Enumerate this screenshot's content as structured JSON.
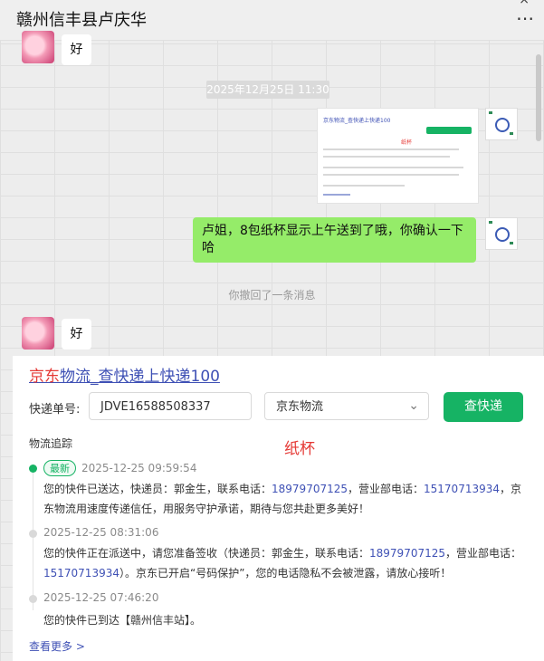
{
  "header": {
    "title": "赣州信丰县卢庆华",
    "more_icon": "⋯",
    "close_icon": "×"
  },
  "chat": {
    "msg1": "好",
    "time": "2025年12月25日 11:30",
    "outgoing": "卢姐，8包纸杯显示上午送到了哦，你确认一下哈",
    "recall_notice": "你撤回了一条消息",
    "msg2": "好"
  },
  "card": {
    "title_red": "京东",
    "title_rest": "物流_查快递上快递100",
    "tracking_label": "快递单号:",
    "tracking_value": "JDVE16588508337",
    "carrier": "京东物流",
    "query_button": "查快递",
    "tracking_section": "物流追踪",
    "stamp_text": "纸杯",
    "events": [
      {
        "badge": "最新",
        "date": "2025-12-25 09:59:54",
        "text_a": "您的快件已送达，快递员：郭金生，联系电话：",
        "phone1": "18979707125",
        "text_b": "，营业部电话：",
        "phone2": "15170713934",
        "text_c": "，京东物流用速度传递信任，用服务守护承诺，期待与您共赴更多美好！"
      },
      {
        "date": "2025-12-25 08:31:06",
        "text_a": "您的快件正在派送中，请您准备签收（快递员：郭金生，联系电话：",
        "phone1": "18979707125",
        "text_b": "，营业部电话：",
        "phone2": "15170713934",
        "text_c": "）。京东已开启“号码保护”，您的电话隐私不会被泄露，请放心接听！"
      },
      {
        "date": "2025-12-25 07:46:20",
        "text_a": "您的快件已到达【赣州信丰站】。"
      }
    ],
    "see_more": "查看更多 >"
  },
  "colors": {
    "accent_green": "#16b364",
    "bubble_green": "#95ec69",
    "link_blue": "#3f51b5",
    "brand_red": "#e53935"
  }
}
